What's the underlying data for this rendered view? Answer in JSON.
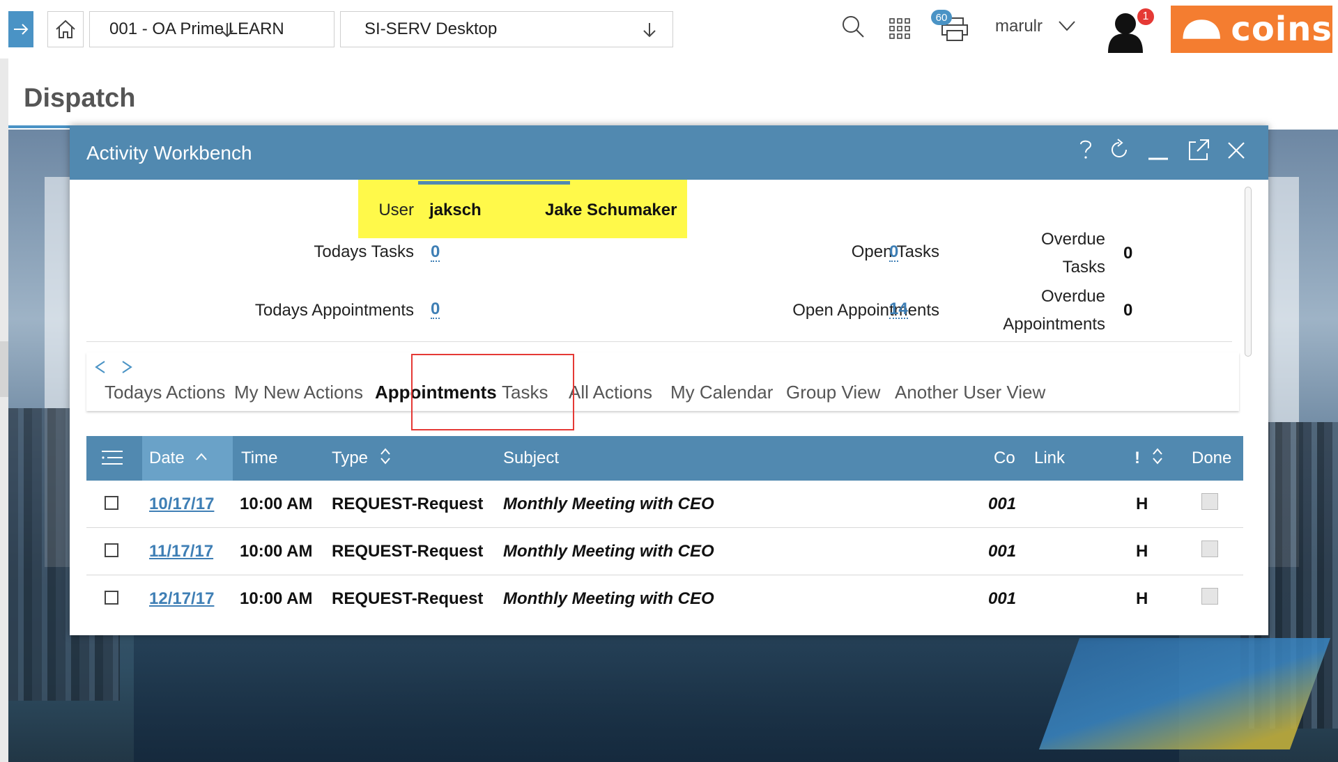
{
  "topbar": {
    "company": "001 - OA Prime LEARN",
    "desktop": "SI-SERV Desktop",
    "print_badge": "60",
    "username": "marulr",
    "notification_badge": "1",
    "logo_text": "coins",
    "logo_color": "#f47d30",
    "icons": [
      "nav-arrow-icon",
      "home-icon",
      "search-icon",
      "apps-grid-icon",
      "printer-icon",
      "chevron-down-icon",
      "user-avatar-icon"
    ]
  },
  "page": {
    "title": "Dispatch"
  },
  "modal": {
    "title": "Activity Workbench",
    "header_color": "#5189b0",
    "controls": [
      "help-icon",
      "refresh-icon",
      "minimize-icon",
      "popout-icon",
      "close-icon"
    ]
  },
  "summary": {
    "user_label": "User",
    "user_id": "jaksch",
    "user_name": "Jake Schumaker",
    "todays_tasks_label": "Todays Tasks",
    "todays_tasks": "0",
    "open_tasks_label": "Open Tasks",
    "open_tasks": "0",
    "overdue_tasks_label_1": "Overdue",
    "overdue_tasks_label_2": "Tasks",
    "overdue_tasks": "0",
    "todays_appts_label": "Todays Appointments",
    "todays_appts": "0",
    "open_appts_label": "Open Appointments",
    "open_appts": "14",
    "overdue_appts_label_1": "Overdue",
    "overdue_appts_label_2": "Appointments",
    "overdue_appts": "0"
  },
  "tabs": [
    {
      "label": "Todays Actions"
    },
    {
      "label": "My New Actions"
    },
    {
      "label": "Appointments",
      "active": true
    },
    {
      "label": "Tasks"
    },
    {
      "label": "All Actions"
    },
    {
      "label": "My Calendar"
    },
    {
      "label": "Group View"
    },
    {
      "label": "Another User View"
    }
  ],
  "table": {
    "columns": [
      "Date",
      "Time",
      "Type",
      "Subject",
      "Co",
      "Link",
      "!",
      "Done"
    ],
    "rows": [
      {
        "date": "10/17/17",
        "time": "10:00 AM",
        "type": "REQUEST-Request",
        "subject": "Monthly Meeting with CEO",
        "co": "001",
        "link": "",
        "priority": "H"
      },
      {
        "date": "11/17/17",
        "time": "10:00 AM",
        "type": "REQUEST-Request",
        "subject": "Monthly Meeting with CEO",
        "co": "001",
        "link": "",
        "priority": "H"
      },
      {
        "date": "12/17/17",
        "time": "10:00 AM",
        "type": "REQUEST-Request",
        "subject": "Monthly Meeting with CEO",
        "co": "001",
        "link": "",
        "priority": "H"
      }
    ]
  }
}
